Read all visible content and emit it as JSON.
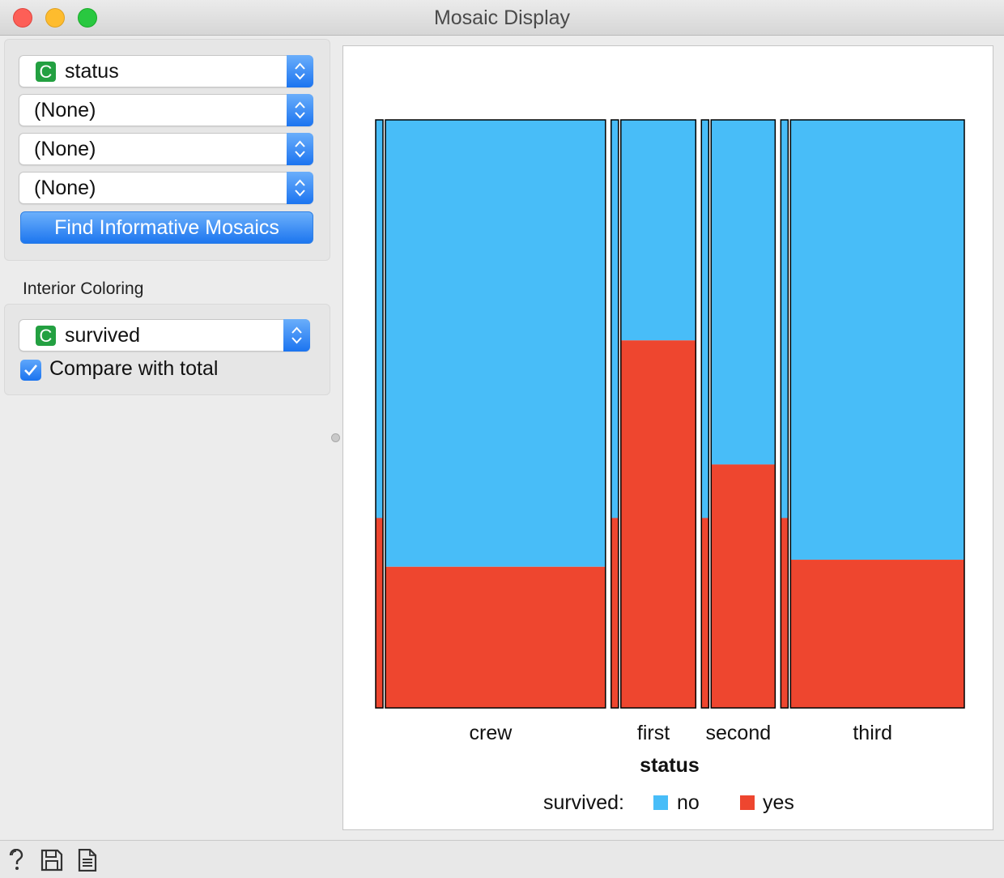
{
  "window": {
    "title": "Mosaic Display"
  },
  "variables": {
    "var1": {
      "badge": "C",
      "label": "status"
    },
    "var2": {
      "label": "(None)"
    },
    "var3": {
      "label": "(None)"
    },
    "var4": {
      "label": "(None)"
    },
    "find_button": "Find Informative Mosaics"
  },
  "interior_coloring": {
    "section_label": "Interior Coloring",
    "combo": {
      "badge": "C",
      "label": "survived"
    },
    "compare_label": "Compare with total",
    "compare_checked": true
  },
  "colors": {
    "no": "#48bdf8",
    "yes": "#ee462f",
    "accent": "#1b74f0"
  },
  "chart_data": {
    "type": "mosaic",
    "xlabel": "status",
    "legend_title": "survived:",
    "legend_placement": "bottom",
    "series": [
      {
        "name": "no"
      },
      {
        "name": "yes"
      }
    ],
    "categories": [
      "crew",
      "first",
      "second",
      "third"
    ],
    "category_share": [
      0.402,
      0.148,
      0.129,
      0.321
    ],
    "yes_fraction": [
      0.24,
      0.625,
      0.414,
      0.252
    ],
    "total_yes_fraction": 0.323
  },
  "footer": {
    "icons": [
      "help-icon",
      "save-icon",
      "report-icon"
    ]
  }
}
